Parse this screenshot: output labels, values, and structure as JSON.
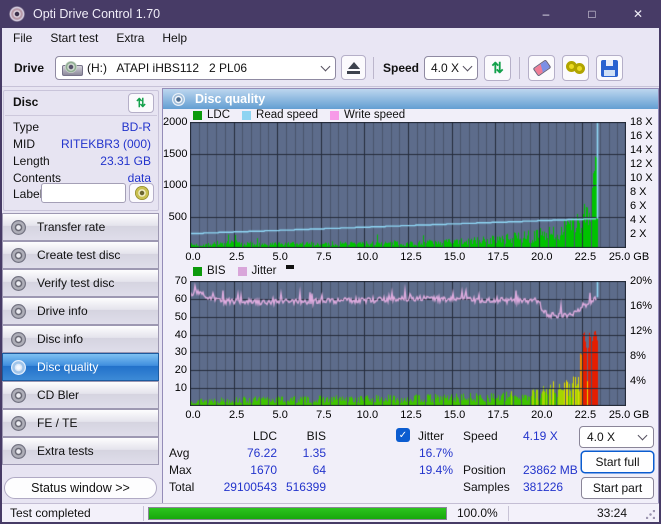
{
  "window": {
    "title": "Opti Drive Control 1.70",
    "controls": {
      "minimize": "–",
      "maximize": "□",
      "close": "✕"
    }
  },
  "menu": {
    "items": [
      "File",
      "Start test",
      "Extra",
      "Help"
    ]
  },
  "toolbar": {
    "drive_label": "Drive",
    "drive_value": "(H:)   ATAPI iHBS112   2 PL06",
    "speed_label": "Speed",
    "speed_value": "4.0 X"
  },
  "disc_panel": {
    "title": "Disc",
    "fields": [
      {
        "label": "Type",
        "value": "BD-R"
      },
      {
        "label": "MID",
        "value": "RITEKBR3 (000)"
      },
      {
        "label": "Length",
        "value": "23.31 GB"
      },
      {
        "label": "Contents",
        "value": "data"
      }
    ],
    "label_field": {
      "label": "Label",
      "value": ""
    }
  },
  "sidebar": {
    "items": [
      {
        "label": "Transfer rate"
      },
      {
        "label": "Create test disc"
      },
      {
        "label": "Verify test disc"
      },
      {
        "label": "Drive info"
      },
      {
        "label": "Disc info"
      },
      {
        "label": "Disc quality",
        "active": true
      },
      {
        "label": "CD Bler"
      },
      {
        "label": "FE / TE"
      },
      {
        "label": "Extra tests"
      }
    ],
    "status_button": "Status window >>"
  },
  "main": {
    "header": "Disc quality",
    "legend1": [
      {
        "label": "LDC",
        "color": "#0c9a0c"
      },
      {
        "label": "Read speed",
        "color": "#8ed4f2"
      },
      {
        "label": "Write speed",
        "color": "#f79ae8"
      }
    ],
    "legend2": [
      {
        "label": "BIS",
        "color": "#0c9a0c"
      },
      {
        "label": "Jitter",
        "color": "#d9a6da"
      }
    ],
    "stats": {
      "col1": "LDC",
      "col2": "BIS",
      "jitter_label": "Jitter",
      "jitter_checked": true,
      "rows": [
        {
          "label": "Avg",
          "ldc": "76.22",
          "bis": "1.35",
          "jitter": "16.7%"
        },
        {
          "label": "Max",
          "ldc": "1670",
          "bis": "64",
          "jitter": "19.4%"
        },
        {
          "label": "Total",
          "ldc": "29100543",
          "bis": "516399",
          "jitter": ""
        }
      ],
      "speed_label": "Speed",
      "speed_value": "4.19 X",
      "position_label": "Position",
      "position_value": "23862 MB",
      "samples_label": "Samples",
      "samples_value": "381226"
    },
    "controls": {
      "speed_select": "4.0 X",
      "start_full": "Start full",
      "start_part": "Start part"
    }
  },
  "status_bar": {
    "text": "Test completed",
    "percent": "100.0%",
    "time": "33:24"
  },
  "chart_data": [
    {
      "type": "area+line",
      "title": "LDC / Read speed",
      "x_max": 25,
      "data_end": 23.38,
      "x": {
        "ticks": [
          0,
          2.5,
          5,
          7.5,
          10,
          12.5,
          15,
          17.5,
          20,
          22.5,
          25
        ],
        "unit": "GB"
      },
      "y_left": {
        "max": 2000,
        "ticks": [
          2000,
          1500,
          1000,
          500
        ]
      },
      "y_right": {
        "max": 18,
        "ticks": [
          18,
          16,
          14,
          12,
          10,
          8,
          6,
          4,
          2
        ],
        "suffix": " X"
      },
      "grid": {
        "x_minor": 0.5,
        "x_major": 2.5,
        "h_lines": [
          500,
          1000,
          1500
        ],
        "h_max": 2000
      },
      "bars": {
        "seed": 7,
        "y_max": 2000,
        "color": "#00c200",
        "spike_prob": 0.012,
        "envelope": [
          [
            0,
            70
          ],
          [
            1,
            78
          ],
          [
            1.5,
            115
          ],
          [
            2,
            95
          ],
          [
            2.6,
            120
          ],
          [
            3,
            100
          ],
          [
            3.6,
            92
          ],
          [
            4,
            82
          ],
          [
            5,
            84
          ],
          [
            6,
            88
          ],
          [
            7,
            92
          ],
          [
            8,
            96
          ],
          [
            9,
            99
          ],
          [
            10,
            102
          ],
          [
            11,
            106
          ],
          [
            12,
            110
          ],
          [
            13,
            115
          ],
          [
            14,
            124
          ],
          [
            15,
            136
          ],
          [
            16,
            152
          ],
          [
            17,
            176
          ],
          [
            18,
            205
          ],
          [
            18.5,
            220
          ],
          [
            19,
            245
          ],
          [
            19.5,
            265
          ],
          [
            20,
            290
          ],
          [
            20.5,
            325
          ],
          [
            21,
            365
          ],
          [
            21.5,
            435
          ],
          [
            22,
            495
          ],
          [
            22.3,
            530
          ],
          [
            22.5,
            575
          ],
          [
            22.7,
            700
          ],
          [
            22.9,
            860
          ],
          [
            23,
            1000
          ],
          [
            23.1,
            1160
          ],
          [
            23.2,
            1390
          ],
          [
            23.28,
            1670
          ],
          [
            23.33,
            1430
          ],
          [
            23.38,
            950
          ]
        ]
      },
      "line": {
        "type": "ramp",
        "start": 2.05,
        "end": 4.19,
        "end_x": 23.3,
        "y_max": 18,
        "quant": 0.08,
        "color": "#90d9f8"
      },
      "spike": {
        "x": 23.35,
        "from": 4.19,
        "color": "#90d9f8"
      }
    },
    {
      "type": "area+line",
      "title": "BIS / Jitter",
      "x_max": 25,
      "data_end": 23.38,
      "x": {
        "ticks": [
          0,
          2.5,
          5,
          7.5,
          10,
          12.5,
          15,
          17.5,
          20,
          22.5,
          25
        ],
        "unit": "GB"
      },
      "y_left": {
        "max": 70,
        "ticks": [
          70,
          60,
          50,
          40,
          30,
          20,
          10
        ]
      },
      "y_right": {
        "max": 20,
        "ticks": [
          20,
          16,
          12,
          8,
          4
        ],
        "suffix": "%"
      },
      "grid": {
        "x_minor": 0.5,
        "x_major": 2.5,
        "h_lines": [
          10,
          20,
          30,
          40,
          50,
          60
        ],
        "h_max": 70
      },
      "bars": {
        "seed": 13,
        "y_max": 70,
        "color_scale": [
          [
            8,
            "#3fc400"
          ],
          [
            13,
            "#a6d500"
          ],
          [
            19,
            "#e3de00"
          ],
          [
            30,
            "#f28a00"
          ],
          [
            9999,
            "#e51d00"
          ]
        ],
        "envelope": [
          [
            0,
            4.5
          ],
          [
            2,
            4.6
          ],
          [
            4,
            5
          ],
          [
            6,
            5.2
          ],
          [
            8,
            5.4
          ],
          [
            10,
            5.6
          ],
          [
            12,
            5.9
          ],
          [
            14,
            6.2
          ],
          [
            16,
            6.6
          ],
          [
            18,
            7.2
          ],
          [
            19,
            8.2
          ],
          [
            19.5,
            9.5
          ],
          [
            20,
            10.5
          ],
          [
            20.5,
            12
          ],
          [
            21,
            13.5
          ],
          [
            21.5,
            14.5
          ],
          [
            22,
            15.5
          ],
          [
            22.2,
            16.5
          ],
          [
            22.35,
            25
          ],
          [
            22.5,
            35
          ],
          [
            22.6,
            47
          ],
          [
            22.7,
            37
          ],
          [
            22.8,
            33
          ],
          [
            22.9,
            41
          ],
          [
            23,
            45
          ],
          [
            23.1,
            43
          ],
          [
            23.2,
            48
          ],
          [
            23.3,
            49
          ],
          [
            23.38,
            43
          ]
        ]
      },
      "line": {
        "type": "noisy",
        "seed": 99,
        "noise": 0.45,
        "y_max": 20,
        "end_x": 23.3,
        "color": "#ddabde",
        "envelope": [
          [
            0,
            17.9
          ],
          [
            0.3,
            18.4
          ],
          [
            0.6,
            18
          ],
          [
            1,
            17.4
          ],
          [
            1.5,
            17
          ],
          [
            2,
            16.8
          ],
          [
            3,
            16.7
          ],
          [
            4,
            16.6
          ],
          [
            5,
            16.7
          ],
          [
            6,
            16.8
          ],
          [
            7,
            16.7
          ],
          [
            8,
            16.8
          ],
          [
            9,
            16.9
          ],
          [
            10,
            16.9
          ],
          [
            11,
            17
          ],
          [
            12,
            17.2
          ],
          [
            13,
            17.2
          ],
          [
            14,
            17.1
          ],
          [
            15,
            17.1
          ],
          [
            16,
            17
          ],
          [
            17,
            17
          ],
          [
            18,
            16.9
          ],
          [
            19,
            16.9
          ],
          [
            20,
            16.8
          ],
          [
            20.3,
            15
          ],
          [
            20.6,
            14.6
          ],
          [
            21,
            14.5
          ],
          [
            21.5,
            14.6
          ],
          [
            22,
            14.7
          ],
          [
            22.2,
            15.2
          ],
          [
            22.5,
            16
          ],
          [
            22.8,
            16.4
          ],
          [
            23,
            16.6
          ],
          [
            23.1,
            16.8
          ],
          [
            23.25,
            17.5
          ],
          [
            23.3,
            17.1
          ]
        ]
      },
      "spike": {
        "x": 23.35,
        "from": 17.4,
        "color": "#90d9f8"
      }
    }
  ]
}
